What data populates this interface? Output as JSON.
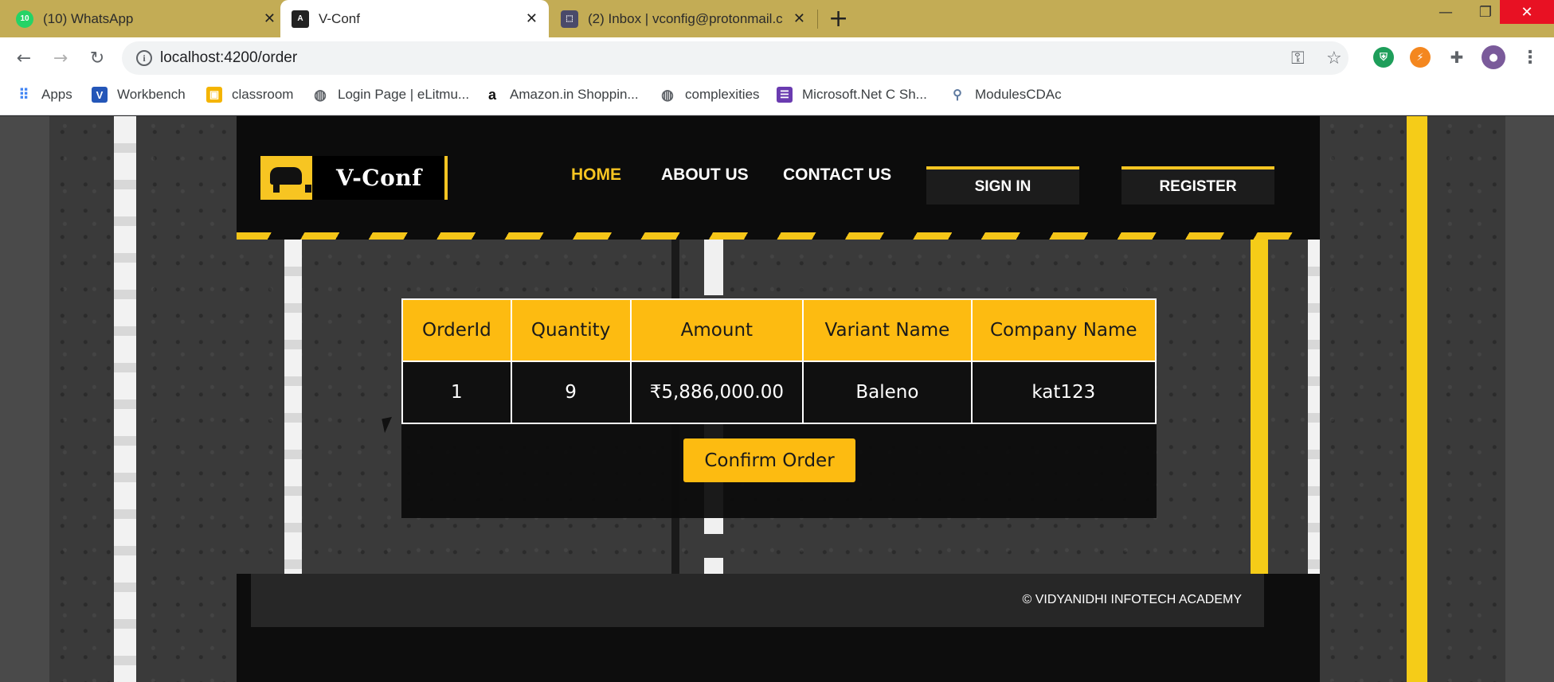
{
  "browser": {
    "tabs": [
      {
        "title": "(10) WhatsApp",
        "badge": "10",
        "icon": "whatsapp-icon",
        "color": "#25d366"
      },
      {
        "title": "V-Conf",
        "icon": "angular-icon",
        "color": "#222222",
        "active": true
      },
      {
        "title": "(2) Inbox | vconfig@protonmail.c",
        "icon": "protonmail-icon",
        "color": "#4a4a6a"
      }
    ],
    "new_tab": "+",
    "url": "localhost:4200/order",
    "bookmarks": [
      {
        "label": "Apps",
        "icon": "apps-grid-icon"
      },
      {
        "label": "Workbench",
        "icon": "vue-icon"
      },
      {
        "label": "classroom",
        "icon": "classroom-icon"
      },
      {
        "label": "Login Page | eLitmu...",
        "icon": "globe-icon"
      },
      {
        "label": "Amazon.in Shoppin...",
        "icon": "amazon-icon"
      },
      {
        "label": "complexities",
        "icon": "globe-icon"
      },
      {
        "label": "Microsoft.Net C Sh...",
        "icon": "list-icon"
      },
      {
        "label": "ModulesCDAc",
        "icon": "bike-icon"
      }
    ]
  },
  "site": {
    "brand": "V-Conf",
    "nav": [
      "HOME",
      "ABOUT US",
      "CONTACT US"
    ],
    "sign_in": "SIGN IN",
    "register": "REGISTER",
    "accent_color": "#fdbb11"
  },
  "order_table": {
    "columns": [
      "OrderId",
      "Quantity",
      "Amount",
      "Variant Name",
      "Company Name"
    ],
    "rows": [
      [
        "1",
        "9",
        "₹5,886,000.00",
        "Baleno",
        "kat123"
      ]
    ]
  },
  "confirm_label": "Confirm Order",
  "footer": "© VIDYANIDHI INFOTECH ACADEMY"
}
